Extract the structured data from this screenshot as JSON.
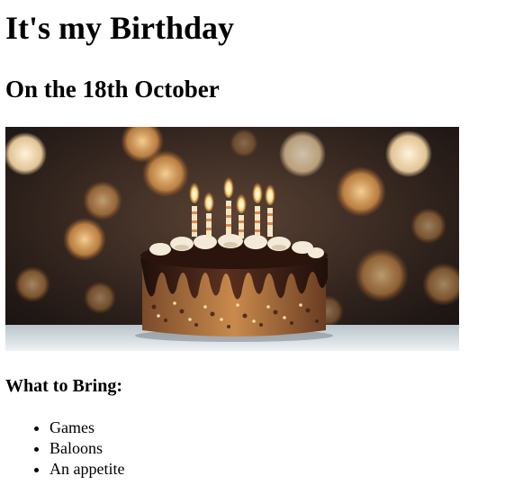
{
  "heading": "It's my Birthday",
  "subheading": "On the 18th October",
  "bring_heading": "What to Bring:",
  "bring_items": [
    "Games",
    "Baloons",
    "An appetite"
  ],
  "image": {
    "subject": "birthday-cake-with-candles",
    "colors": {
      "background_dark": "#2a1d18",
      "bokeh": "#e8a95a",
      "chocolate": "#3b1f14",
      "cream": "#f4ead8",
      "table": "#dfe6ea",
      "flame": "#ffd36b"
    }
  }
}
